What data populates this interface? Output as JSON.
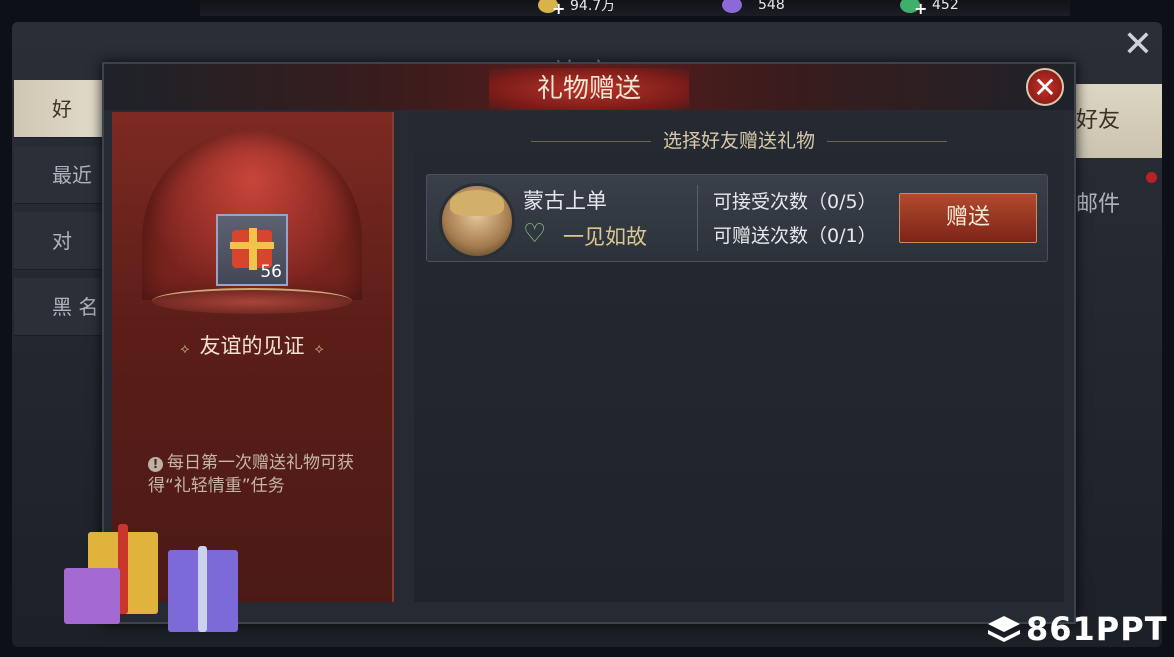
{
  "currencies": [
    {
      "icon": "gold-coin-icon",
      "value": "94.7万",
      "color": "#d8b24a"
    },
    {
      "icon": "purple-gem-icon",
      "value": "548",
      "color": "#8b6ad8"
    },
    {
      "icon": "green-gem-icon",
      "value": "452",
      "color": "#3fb06b"
    }
  ],
  "background_window": {
    "title": "社交",
    "left_tabs": [
      "好",
      "最近联",
      "对",
      "黑 名"
    ],
    "right_tabs": [
      "好友",
      "邮件"
    ]
  },
  "modal": {
    "title": "礼物赠送",
    "left_panel": {
      "gift_count": "56",
      "gift_name": "友谊的见证",
      "tip": "每日第一次赠送礼物可获得“礼轻情重”任务"
    },
    "section_title": "选择好友赠送礼物",
    "friends": [
      {
        "name": "蒙古上单",
        "relation": "一见如故",
        "accept_count": "可接受次数（0/5）",
        "send_count": "可赠送次数（0/1）",
        "button_label": "赠送"
      }
    ]
  },
  "watermark": "861PPT",
  "colors": {
    "accent_red": "#b24a2e",
    "gold_text": "#d7c8a8",
    "heart_green": "#7fd18a"
  }
}
